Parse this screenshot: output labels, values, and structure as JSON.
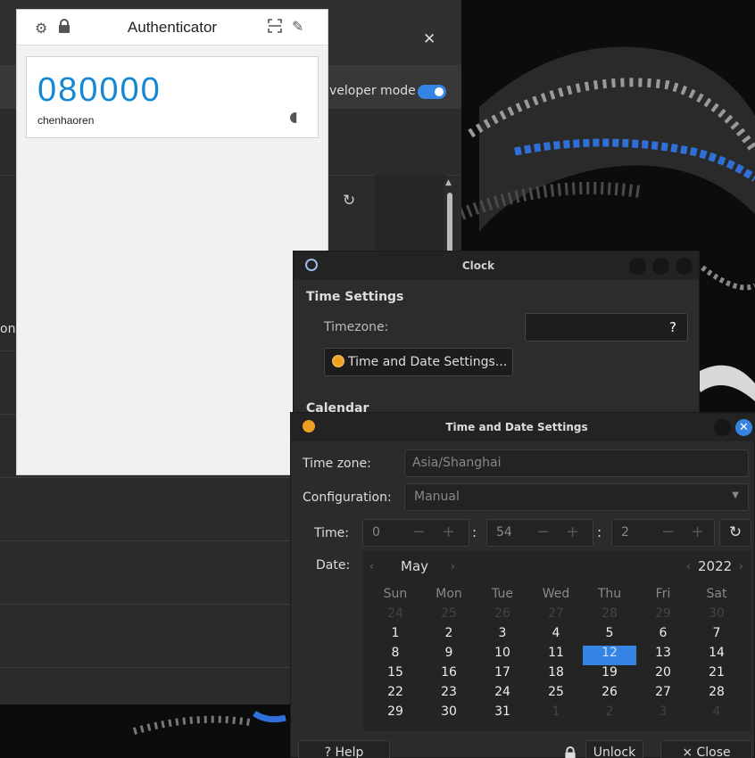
{
  "settings_panel": {
    "developer_mode_label": "veloper mode",
    "left_text": "on"
  },
  "authenticator": {
    "title": "Authenticator",
    "code": "080000",
    "account": "chenhaoren"
  },
  "clock": {
    "title": "Clock",
    "section_time": "Time Settings",
    "timezone_label": "Timezone:",
    "timezone_value": "?",
    "td_button": "Time and Date Settings...",
    "section_calendar": "Calendar"
  },
  "time_date": {
    "title": "Time and Date Settings",
    "timezone_label": "Time zone:",
    "timezone_value": "Asia/Shanghai",
    "config_label": "Configuration:",
    "config_value": "Manual",
    "time_label": "Time:",
    "hour": "0",
    "minute": "54",
    "second": "2",
    "date_label": "Date:",
    "month": "May",
    "year": "2022",
    "weekdays": [
      "Sun",
      "Mon",
      "Tue",
      "Wed",
      "Thu",
      "Fri",
      "Sat"
    ],
    "weeks": [
      [
        "24",
        "25",
        "26",
        "27",
        "28",
        "29",
        "30"
      ],
      [
        "1",
        "2",
        "3",
        "4",
        "5",
        "6",
        "7"
      ],
      [
        "8",
        "9",
        "10",
        "11",
        "12",
        "13",
        "14"
      ],
      [
        "15",
        "16",
        "17",
        "18",
        "19",
        "20",
        "21"
      ],
      [
        "22",
        "23",
        "24",
        "25",
        "26",
        "27",
        "28"
      ],
      [
        "29",
        "30",
        "31",
        "1",
        "2",
        "3",
        "4"
      ]
    ],
    "selected_day": "12",
    "help_label": "? Help",
    "unlock_label": "Unlock",
    "close_label": "× Close"
  }
}
